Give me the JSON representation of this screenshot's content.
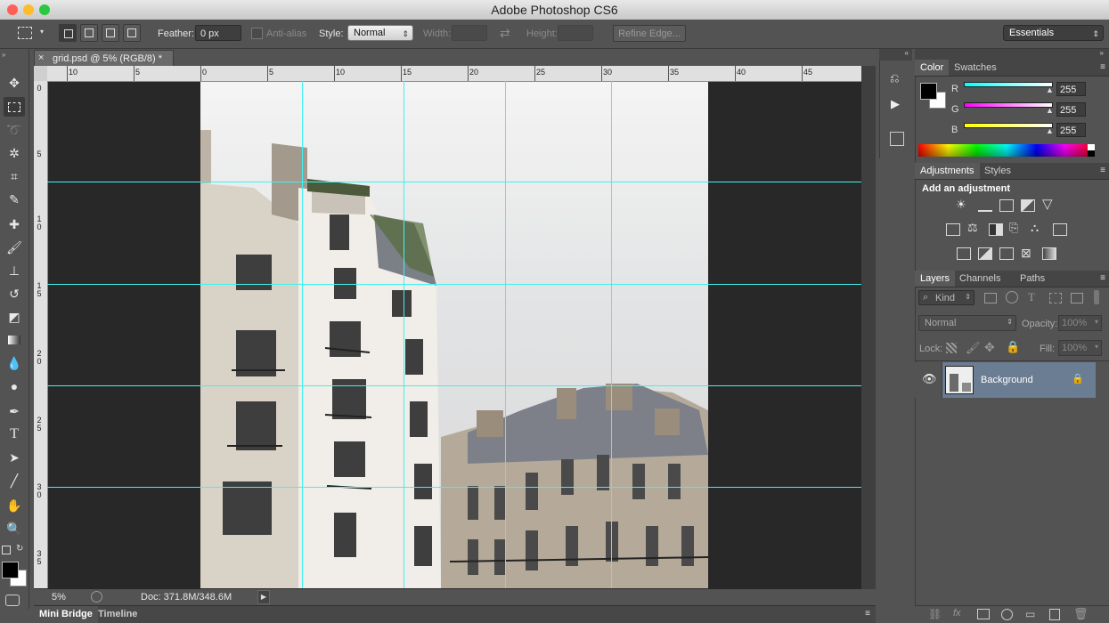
{
  "app": {
    "title": "Adobe Photoshop CS6"
  },
  "options": {
    "feather_label": "Feather:",
    "feather_value": "0 px",
    "antialias_label": "Anti-alias",
    "style_label": "Style:",
    "style_value": "Normal",
    "width_label": "Width:",
    "height_label": "Height:",
    "refine_label": "Refine Edge...",
    "workspace": "Essentials"
  },
  "document": {
    "tab_title": "grid.psd @ 5% (RGB/8) *",
    "close": "×"
  },
  "ruler": {
    "h_labels": [
      "10",
      "5",
      "0",
      "5",
      "10",
      "15",
      "20",
      "25",
      "30",
      "35",
      "40",
      "45"
    ],
    "v_labels": [
      [
        "0"
      ],
      [
        "5"
      ],
      [
        "1",
        "0"
      ],
      [
        "1",
        "5"
      ],
      [
        "2",
        "0"
      ],
      [
        "2",
        "5"
      ],
      [
        "3",
        "0"
      ],
      [
        "3",
        "5"
      ]
    ]
  },
  "status": {
    "zoom": "5%",
    "doc": "Doc: 371.8M/348.6M"
  },
  "bottom_tabs": [
    "Mini Bridge",
    "Timeline"
  ],
  "color_panel": {
    "tabs": [
      "Color",
      "Swatches"
    ],
    "channels": [
      {
        "label": "R",
        "value": "255",
        "color": "#24e3ea"
      },
      {
        "label": "G",
        "value": "255",
        "color": "#e32fd6"
      },
      {
        "label": "B",
        "value": "255",
        "color": "#f0f02b"
      }
    ]
  },
  "adjustments_panel": {
    "tabs": [
      "Adjustments",
      "Styles"
    ],
    "heading": "Add an adjustment"
  },
  "layers_panel": {
    "tabs": [
      "Layers",
      "Channels",
      "Paths"
    ],
    "kind_label": "Kind",
    "blend_mode": "Normal",
    "opacity_label": "Opacity:",
    "opacity_value": "100%",
    "lock_label": "Lock:",
    "fill_label": "Fill:",
    "fill_value": "100%",
    "layers": [
      {
        "name": "Background",
        "locked": true,
        "visible": true
      }
    ]
  },
  "icons": {
    "eye": "eye-icon",
    "lock": "lock-icon"
  }
}
